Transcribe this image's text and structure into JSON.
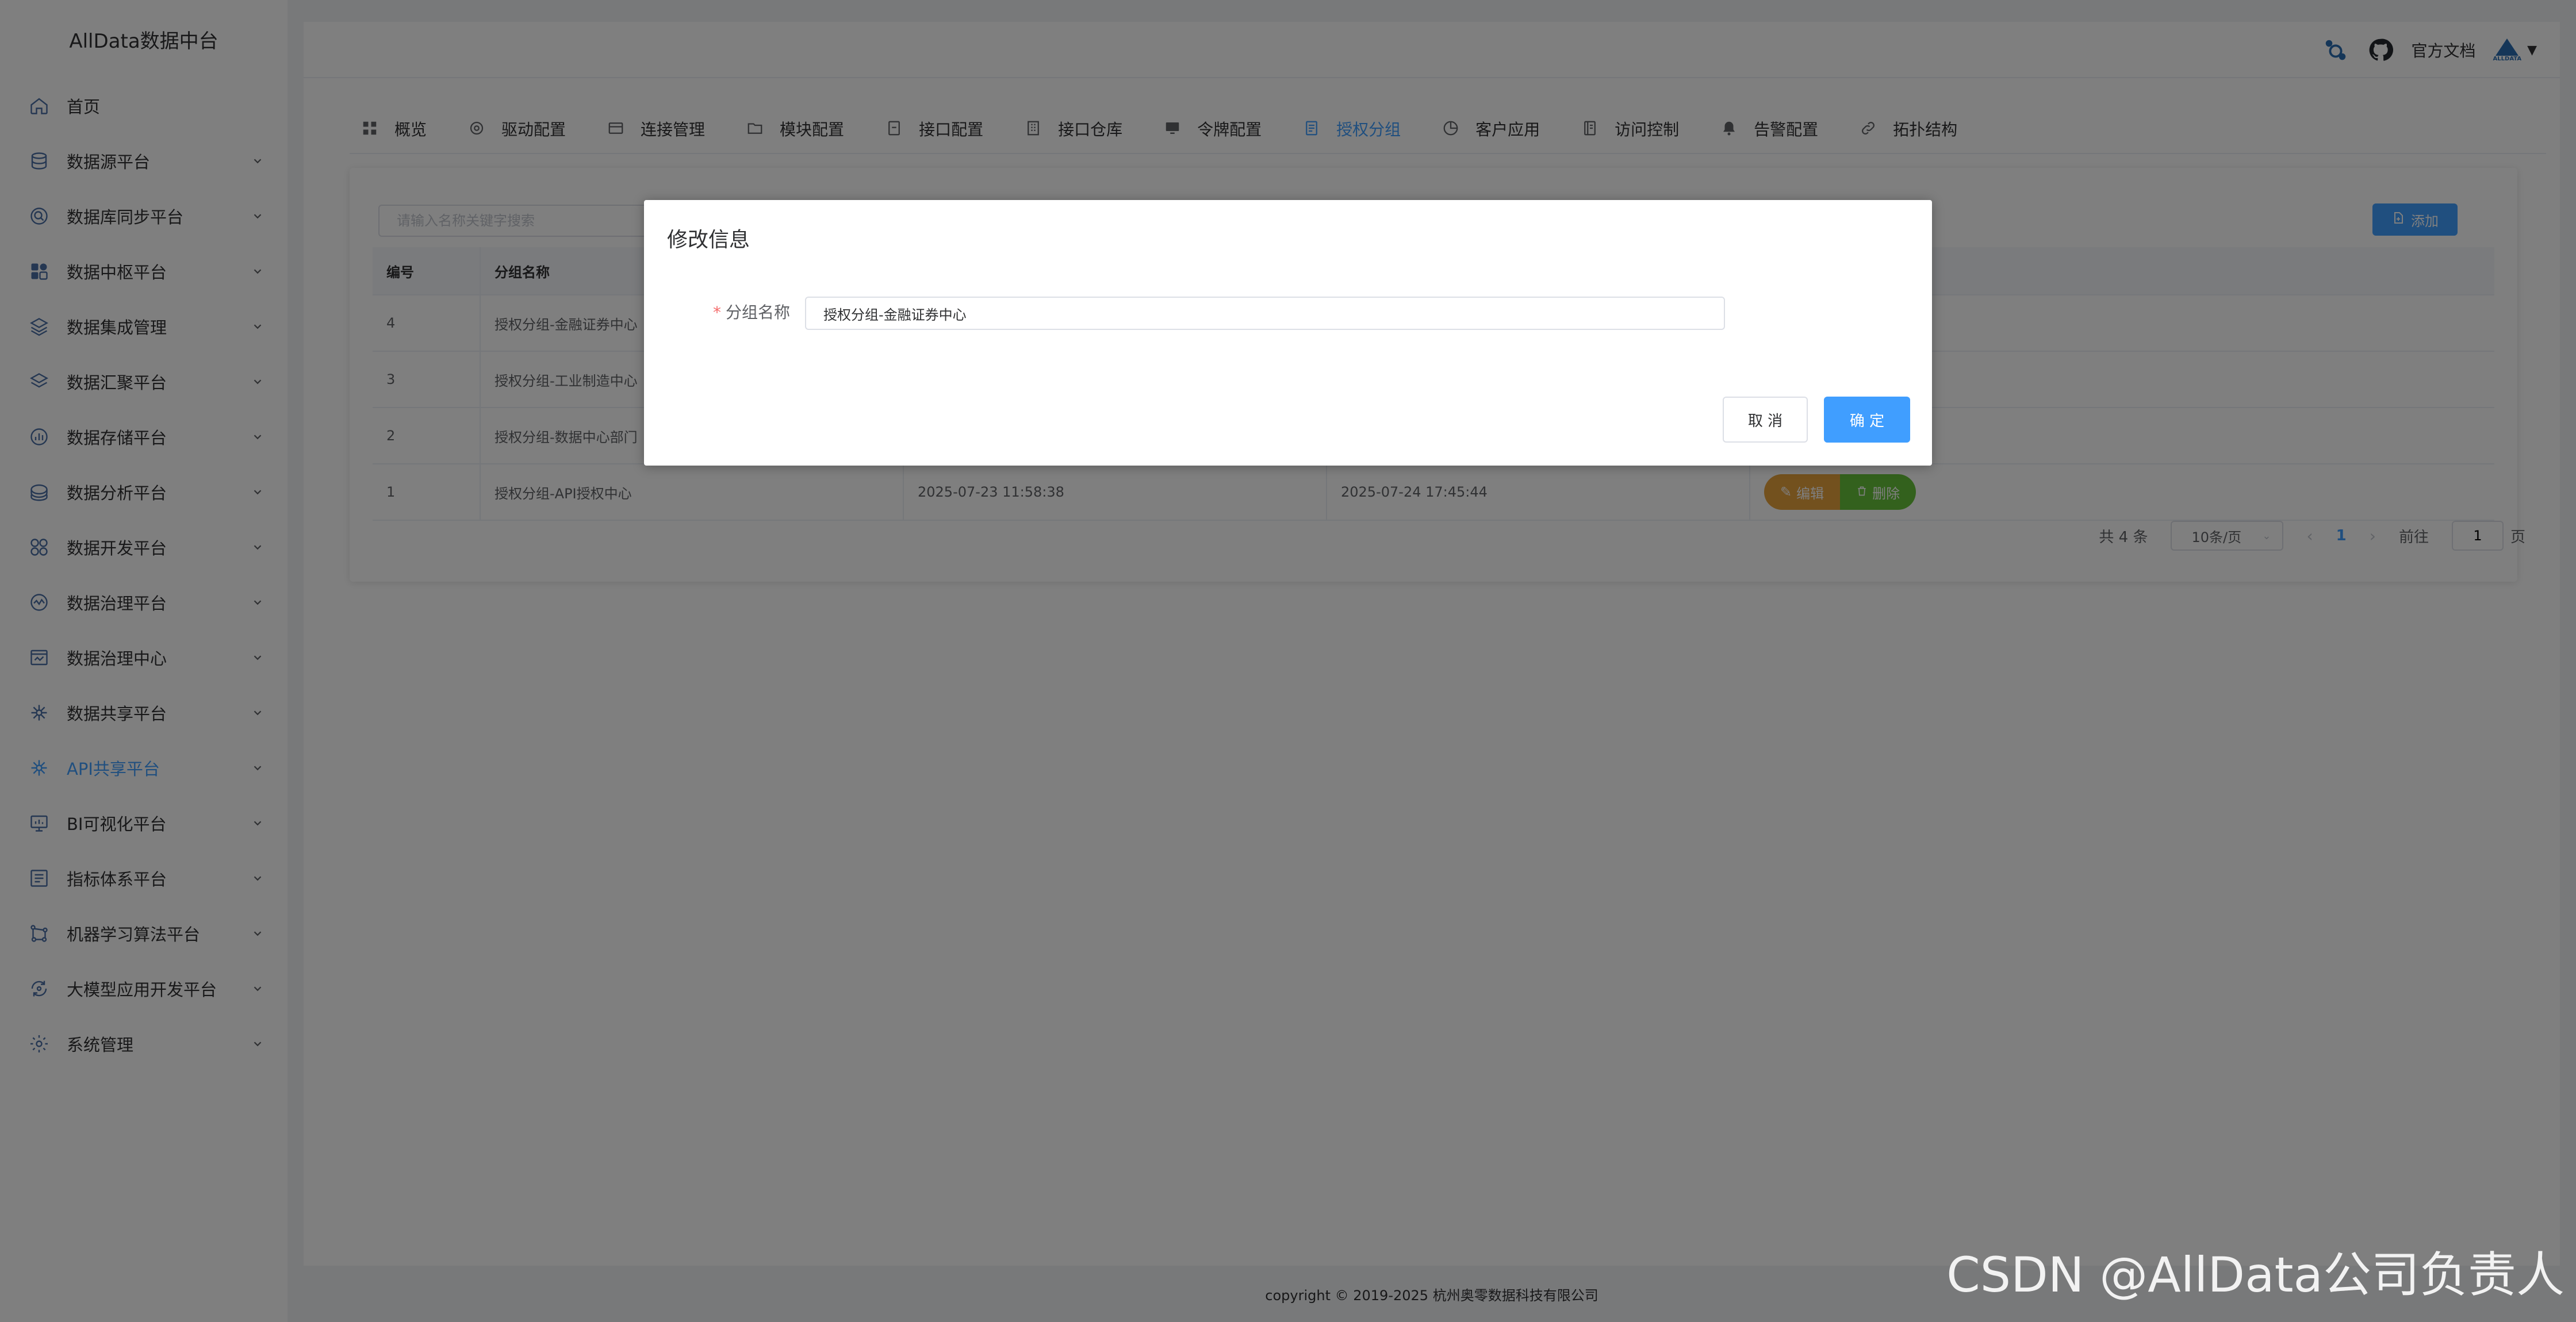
{
  "sidebar": {
    "brand": "AllData数据中台",
    "items": [
      {
        "label": "首页",
        "icon": "home-icon"
      },
      {
        "label": "数据源平台",
        "icon": "database-icon"
      },
      {
        "label": "数据库同步平台",
        "icon": "sync-icon"
      },
      {
        "label": "数据中枢平台",
        "icon": "hub-icon"
      },
      {
        "label": "数据集成管理",
        "icon": "layers-icon"
      },
      {
        "label": "数据汇聚平台",
        "icon": "stack-icon"
      },
      {
        "label": "数据存储平台",
        "icon": "storage-icon"
      },
      {
        "label": "数据分析平台",
        "icon": "analysis-icon"
      },
      {
        "label": "数据开发平台",
        "icon": "dev-icon"
      },
      {
        "label": "数据治理平台",
        "icon": "governance-icon"
      },
      {
        "label": "数据治理中心",
        "icon": "governance-center-icon"
      },
      {
        "label": "数据共享平台",
        "icon": "share-icon"
      },
      {
        "label": "API共享平台",
        "icon": "api-icon"
      },
      {
        "label": "BI可视化平台",
        "icon": "bi-icon"
      },
      {
        "label": "指标体系平台",
        "icon": "metrics-icon"
      },
      {
        "label": "机器学习算法平台",
        "icon": "ml-icon"
      },
      {
        "label": "大模型应用开发平台",
        "icon": "llm-icon"
      },
      {
        "label": "系统管理",
        "icon": "settings-icon"
      }
    ]
  },
  "header": {
    "docs_label": "官方文档",
    "avatar_label": "ALLDATA"
  },
  "tabs": [
    {
      "label": "概览"
    },
    {
      "label": "驱动配置"
    },
    {
      "label": "连接管理"
    },
    {
      "label": "模块配置"
    },
    {
      "label": "接口配置"
    },
    {
      "label": "接口仓库"
    },
    {
      "label": "令牌配置"
    },
    {
      "label": "授权分组"
    },
    {
      "label": "客户应用"
    },
    {
      "label": "访问控制"
    },
    {
      "label": "告警配置"
    },
    {
      "label": "拓扑结构"
    }
  ],
  "toolbar": {
    "search_placeholder": "请输入名称关键字搜索",
    "add_label": "添加"
  },
  "table": {
    "columns": [
      "编号",
      "分组名称",
      "",
      "",
      ""
    ],
    "rows": [
      {
        "id": "4",
        "name": "授权分组-金融证券中心",
        "created": "",
        "updated": ""
      },
      {
        "id": "3",
        "name": "授权分组-工业制造中心",
        "created": "",
        "updated": ""
      },
      {
        "id": "2",
        "name": "授权分组-数据中心部门",
        "created": "",
        "updated": ""
      },
      {
        "id": "1",
        "name": "授权分组-API授权中心",
        "created": "2025-07-23 11:58:38",
        "updated": "2025-07-24 17:45:44"
      }
    ],
    "edit_label": "编辑",
    "delete_label": "删除"
  },
  "pagination": {
    "total_label": "共 4 条",
    "page_size": "10条/页",
    "current_page": "1",
    "goto_label": "前往",
    "goto_value": "1",
    "page_suffix": "页"
  },
  "footer": {
    "copyright": "copyright © 2019-2025 杭州奥零数据科技有限公司"
  },
  "watermark": "CSDN @AllData公司负责人",
  "dialog": {
    "title": "修改信息",
    "field_label": "分组名称",
    "field_value": "授权分组-金融证券中心",
    "cancel_label": "取 消",
    "ok_label": "确 定"
  },
  "colors": {
    "primary": "#409eff",
    "warning": "#e6a23c",
    "success": "#67c23a",
    "danger": "#f56c6c"
  }
}
